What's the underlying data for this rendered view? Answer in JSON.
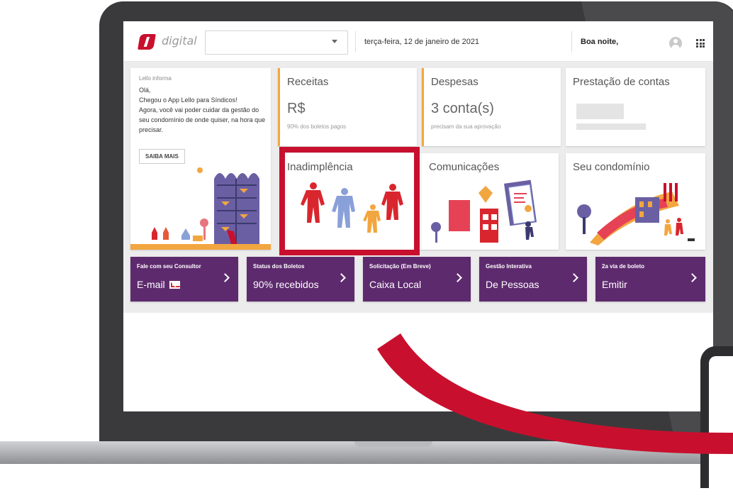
{
  "header": {
    "logo_text": "digital",
    "select_value": "",
    "date": "terça-feira, 12 de janeiro de 2021",
    "greeting": "Boa noite,"
  },
  "info": {
    "small_title": "Lello informa",
    "body": "Olá,\nChegou o App Lello para Síndicos!\nAgora, você vai poder cuidar da gestão do seu condomínio de onde quiser, na hora que precisar.",
    "button": "SAIBA MAIS"
  },
  "cards": {
    "receitas": {
      "title": "Receitas",
      "value": "R$",
      "sub": "90% dos boletos pagos"
    },
    "despesas": {
      "title": "Despesas",
      "value": "3 conta(s)",
      "sub": "precisam da sua aprovação"
    },
    "prestacao": {
      "title": "Prestação de contas"
    },
    "inadimplencia": {
      "title": "Inadimplência"
    },
    "comunicacoes": {
      "title": "Comunicações"
    },
    "condominio": {
      "title": "Seu condomínio"
    }
  },
  "actions": [
    {
      "small": "Fale com seu Consultor",
      "big": "E-mail"
    },
    {
      "small": "Status dos Boletos",
      "big": "90% recebidos"
    },
    {
      "small": "Solicitação (Em Breve)",
      "big": "Caixa Local"
    },
    {
      "small": "Gestão Interativa",
      "big": "De Pessoas"
    },
    {
      "small": "2a via de boleto",
      "big": "Emitir"
    }
  ],
  "colors": {
    "brand_red": "#c8102e",
    "purple": "#5e2a6e",
    "accent_orange": "#f2a640"
  }
}
